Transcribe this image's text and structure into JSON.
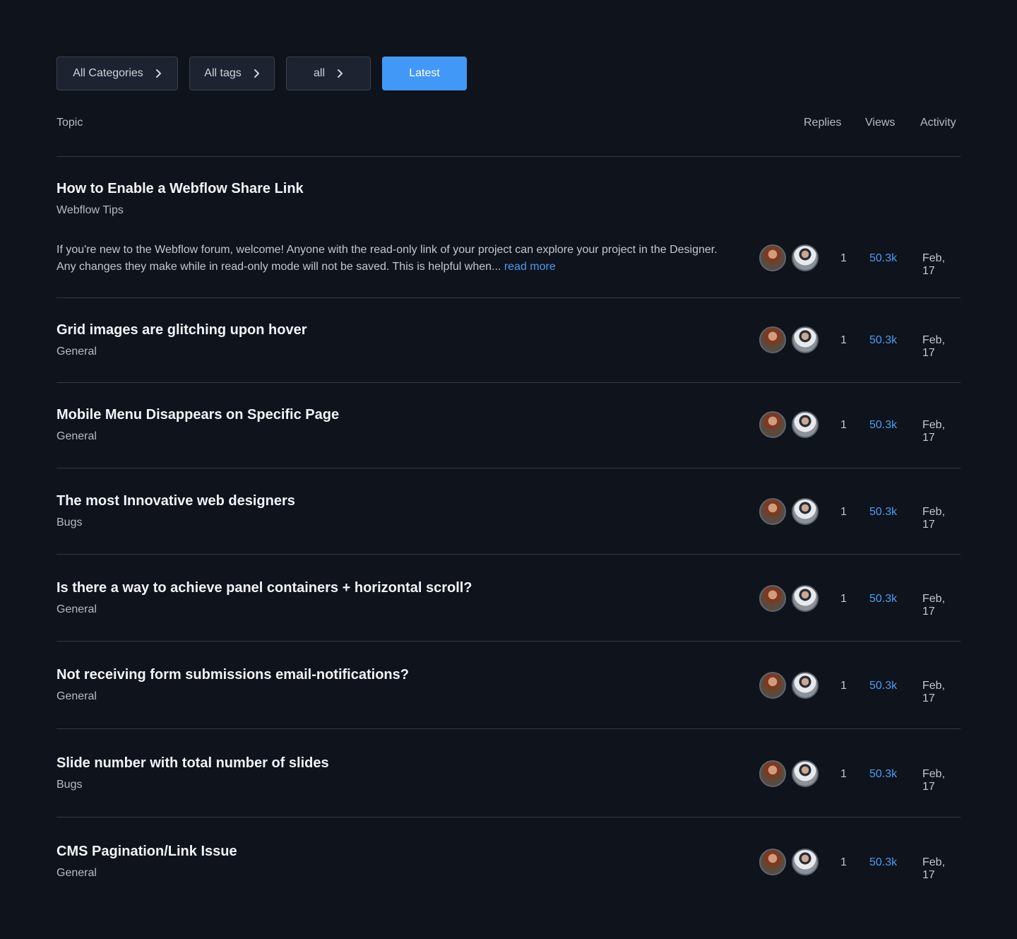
{
  "filters": {
    "categories_label": "All Categories",
    "tags_label": "All tags",
    "all_label": "all",
    "latest_label": "Latest"
  },
  "table": {
    "headers": {
      "topic": "Topic",
      "replies": "Replies",
      "views": "Views",
      "activity": "Activity"
    },
    "rows": [
      {
        "title": "How to Enable a Webflow Share Link",
        "category": "Webflow Tips",
        "excerpt": "If you're new to the Webflow forum, welcome! Anyone with the read-only link of your project can explore your project in the Designer. Any changes they make while in read-only mode will not be saved. This is helpful when...",
        "read_more": "read more",
        "replies": "1",
        "views": "50.3k",
        "activity": "Feb, 17"
      },
      {
        "title": "Grid images are glitching upon hover",
        "category": "General",
        "replies": "1",
        "views": "50.3k",
        "activity": "Feb, 17"
      },
      {
        "title": "Mobile Menu Disappears on Specific Page",
        "category": "General",
        "replies": "1",
        "views": "50.3k",
        "activity": "Feb, 17"
      },
      {
        "title": "The most Innovative web designers",
        "category": "Bugs",
        "replies": "1",
        "views": "50.3k",
        "activity": "Feb, 17"
      },
      {
        "title": "Is there a way to achieve panel containers + horizontal scroll?",
        "category": "General",
        "replies": "1",
        "views": "50.3k",
        "activity": "Feb, 17"
      },
      {
        "title": "Not receiving form submissions email-notifications?",
        "category": "General",
        "replies": "1",
        "views": "50.3k",
        "activity": "Feb, 17"
      },
      {
        "title": "Slide number with total number of slides",
        "category": "Bugs",
        "replies": "1",
        "views": "50.3k",
        "activity": "Feb, 17"
      },
      {
        "title": "CMS Pagination/Link Issue",
        "category": "General",
        "replies": "1",
        "views": "50.3k",
        "activity": "Feb, 17"
      }
    ]
  },
  "colors": {
    "background": "#0e131c",
    "accent": "#4298f7",
    "link": "#4a9cf7"
  }
}
